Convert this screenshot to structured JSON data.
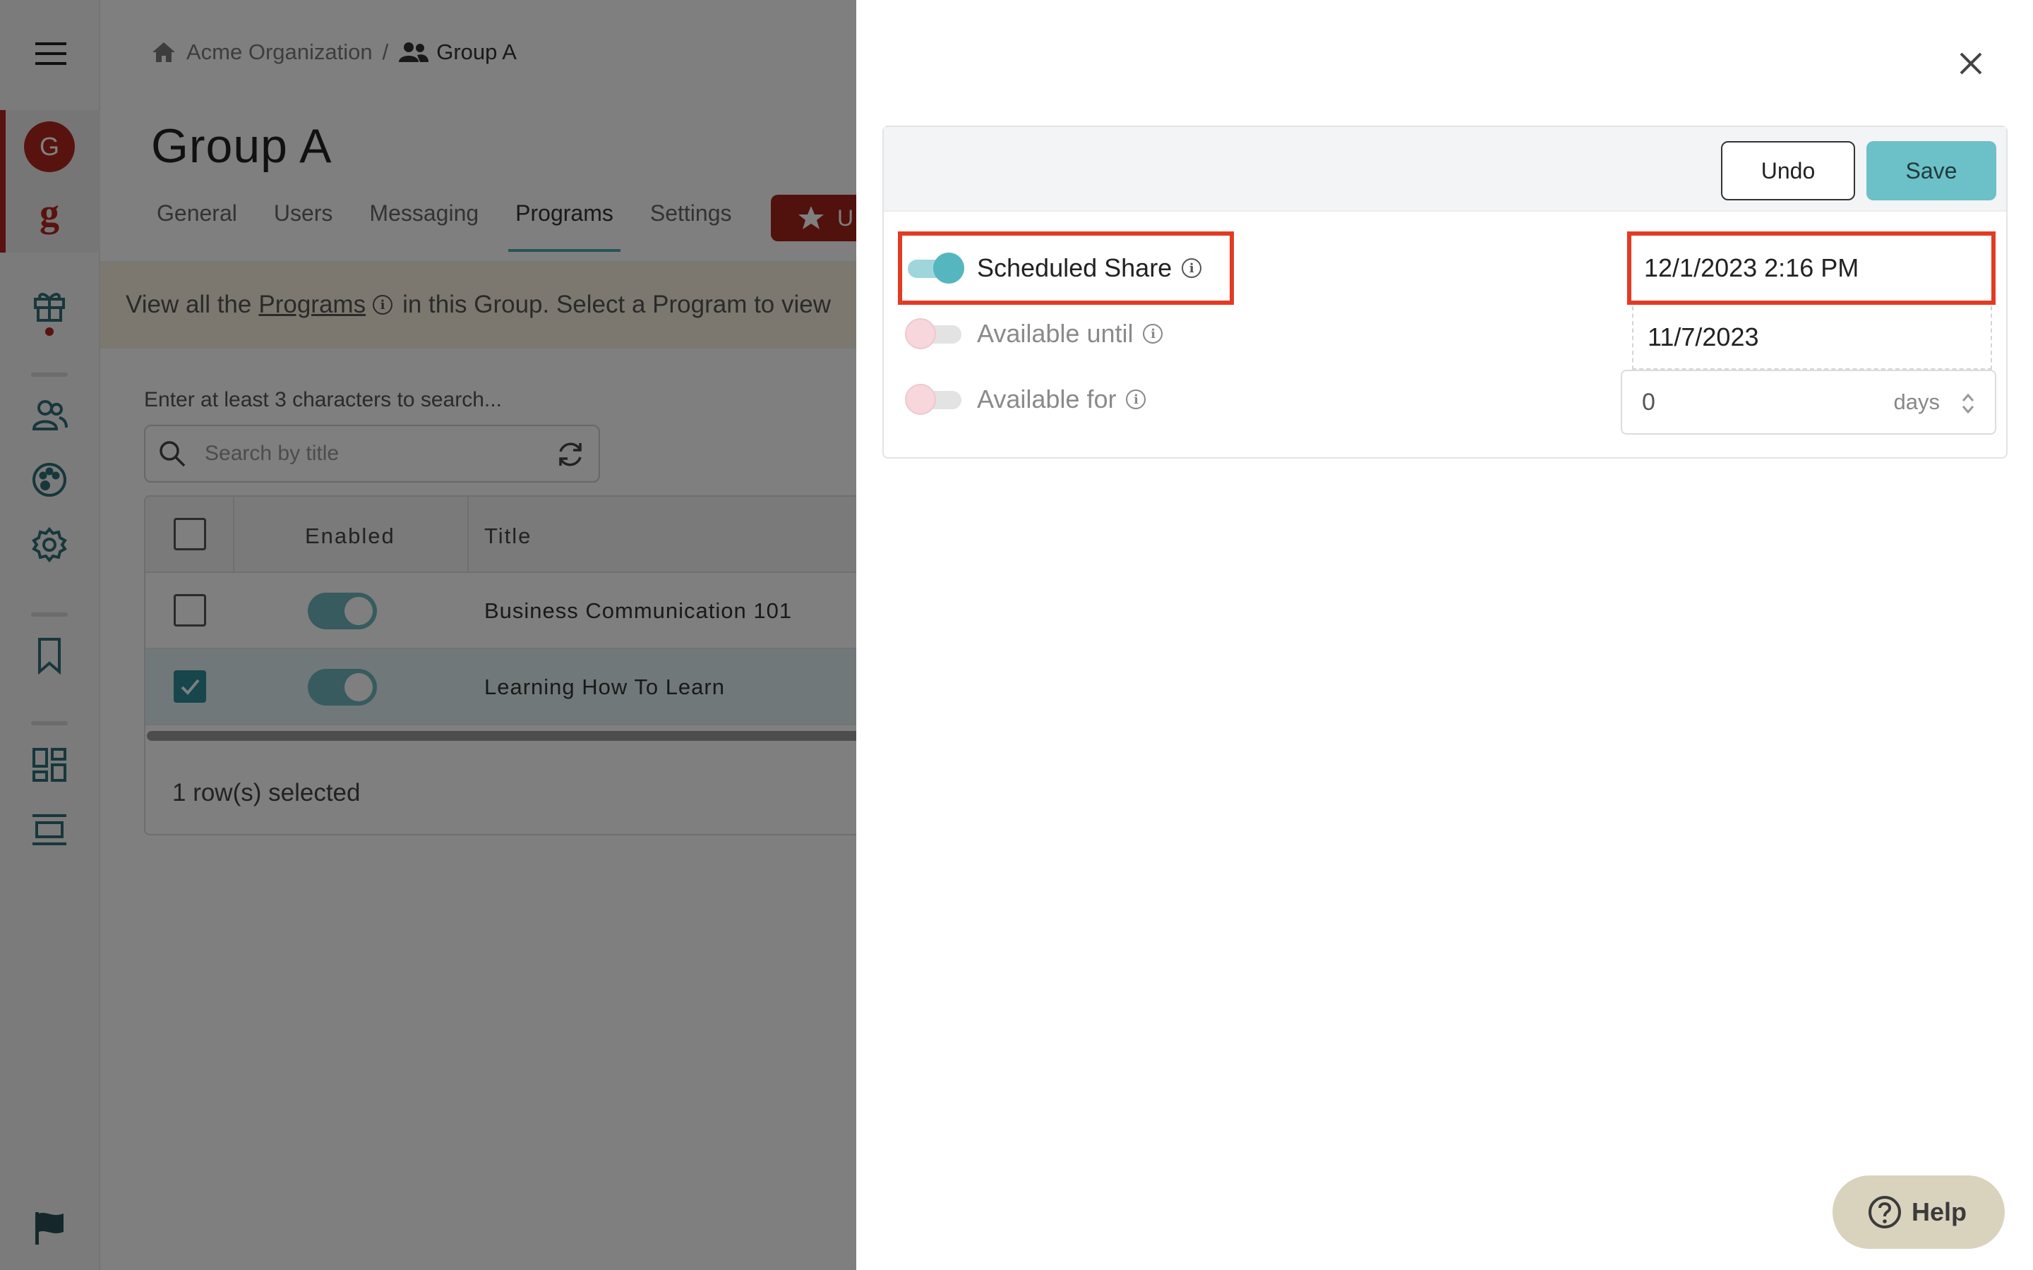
{
  "sidebar": {
    "avatar_initial": "G",
    "brand_letter": "g"
  },
  "breadcrumb": {
    "org": "Acme Organization",
    "separator": "/",
    "group": "Group A"
  },
  "page": {
    "title": "Group A"
  },
  "tabs": [
    {
      "label": "General"
    },
    {
      "label": "Users"
    },
    {
      "label": "Messaging"
    },
    {
      "label": "Programs",
      "active": true
    },
    {
      "label": "Settings"
    }
  ],
  "upgrade": {
    "label": "U"
  },
  "banner": {
    "prefix": "View all the",
    "link": "Programs",
    "suffix": "in this Group. Select a Program to view"
  },
  "search": {
    "hint": "Enter at least 3 characters to search...",
    "placeholder": "Search by title"
  },
  "table": {
    "headers": {
      "enabled": "Enabled",
      "title": "Title"
    },
    "rows": [
      {
        "title": "Business Communication 101",
        "checked": false,
        "enabled": true
      },
      {
        "title": "Learning How To Learn",
        "checked": true,
        "enabled": true
      }
    ],
    "footer": "1 row(s) selected"
  },
  "drawer": {
    "undo_label": "Undo",
    "save_label": "Save",
    "scheduled_share": {
      "label": "Scheduled Share",
      "on": true,
      "value": "12/1/2023 2:16 PM"
    },
    "available_until": {
      "label": "Available until",
      "on": false,
      "value": "11/7/2023"
    },
    "available_for": {
      "label": "Available for",
      "on": false,
      "value": "0",
      "unit": "days"
    }
  },
  "help": {
    "label": "Help"
  },
  "colors": {
    "accent": "#6cc0c7",
    "brand": "#b3261e",
    "highlight": "#e23b23"
  }
}
